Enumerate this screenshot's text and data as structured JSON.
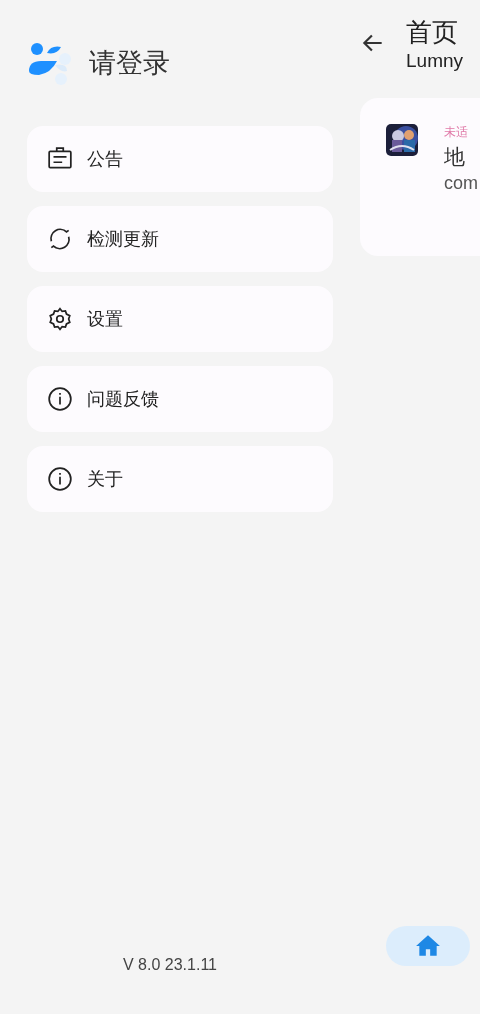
{
  "drawer": {
    "title": "请登录",
    "items": [
      {
        "label": "公告",
        "kind": "notice"
      },
      {
        "label": "检测更新",
        "kind": "refresh"
      },
      {
        "label": "设置",
        "kind": "settings"
      },
      {
        "label": "问题反馈",
        "kind": "info"
      },
      {
        "label": "关于",
        "kind": "info"
      }
    ],
    "version": "V 8.0 23.1.11"
  },
  "main": {
    "title": "首页",
    "subtitle": "Lumny",
    "card": {
      "kind": "picture",
      "tag": "未适",
      "name": "地",
      "package": "com"
    },
    "nav": [
      {
        "kind": "home",
        "selected": true
      }
    ]
  }
}
